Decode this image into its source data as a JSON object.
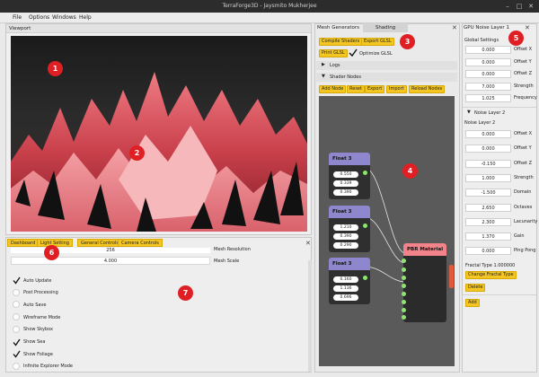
{
  "window": {
    "title": "TerraForge3D - Jaysmito Mukherjee"
  },
  "menu": [
    "File",
    "Options",
    "Windows",
    "Help"
  ],
  "viewport": {
    "title": "Viewport"
  },
  "mesh_panel": {
    "tabs": [
      "Mesh Generators",
      "Shading"
    ],
    "compile_shaders": "Compile Shaders",
    "export_glsl": "Export GLSL",
    "print_glsl": "Print GLSL",
    "optimize_glsl": "Optimize GLSL",
    "logs": "Logs",
    "shader_nodes": "Shader Nodes",
    "node_buttons": [
      "Add Node",
      "Reset",
      "Export",
      "Import",
      "Reload Nodes"
    ]
  },
  "nodes": [
    {
      "title": "Float 3",
      "values": [
        "0.550",
        "0.339",
        "0.390"
      ]
    },
    {
      "title": "Float 3",
      "values": [
        "1.210",
        "0.390",
        "0.290"
      ]
    },
    {
      "title": "Float 3",
      "values": [
        "0.160",
        "1.136",
        "0.696"
      ]
    }
  ],
  "pbr_node": {
    "title": "PBR Material"
  },
  "noise_panel": {
    "title": "GPU Noise Layer 1",
    "global_settings": "Global Settings",
    "global": [
      {
        "value": "0.000",
        "label": "Offset X"
      },
      {
        "value": "0.000",
        "label": "Offset Y"
      },
      {
        "value": "0.000",
        "label": "Offset Z"
      },
      {
        "value": "7.000",
        "label": "Strength"
      },
      {
        "value": "1.025",
        "label": "Frequency"
      }
    ],
    "layer2_header": "Noise Layer 2",
    "layer2_title": "Noise Layer 2",
    "layer2": [
      {
        "value": "0.000",
        "label": "Offset X"
      },
      {
        "value": "0.000",
        "label": "Offset Y"
      },
      {
        "value": "-0.150",
        "label": "Offset Z"
      },
      {
        "value": "1.000",
        "label": "Strength"
      },
      {
        "value": "-1.500",
        "label": "Domain"
      },
      {
        "value": "2.650",
        "label": "Octaves"
      },
      {
        "value": "2.300",
        "label": "Lacunarity"
      },
      {
        "value": "1.370",
        "label": "Gain"
      },
      {
        "value": "0.000",
        "label": "Ping Pong"
      }
    ],
    "fractal_type": "Fractal Type 1.000000",
    "change_fractal": "Change Fractal Type",
    "delete": "Delete",
    "add": "Add"
  },
  "bottom_panel": {
    "tabs": [
      "Dashboard",
      "Light Setting",
      "General Controls",
      "Camera Controls"
    ],
    "mesh_resolution_value": "256",
    "mesh_resolution_label": "Mesh Resolution",
    "mesh_scale_value": "4.000",
    "mesh_scale_label": "Mesh Scale",
    "options": [
      {
        "label": "Auto Update",
        "checked": true
      },
      {
        "label": "Post Processing",
        "checked": false
      },
      {
        "label": "Auto Save",
        "checked": false
      },
      {
        "label": "Wireframe Mode",
        "checked": false
      },
      {
        "label": "Show Skybox",
        "checked": false
      },
      {
        "label": "Show Sea",
        "checked": true
      },
      {
        "label": "Show Foliage",
        "checked": true
      },
      {
        "label": "Infinite Explorer Mode",
        "checked": false
      }
    ]
  },
  "badges": [
    "1",
    "2",
    "3",
    "4",
    "5",
    "6",
    "7"
  ],
  "colors": {
    "accent": "#f3c623",
    "badge": "#e01f25",
    "node_header": "#8e87ce",
    "pbr_header": "#f3838b"
  }
}
